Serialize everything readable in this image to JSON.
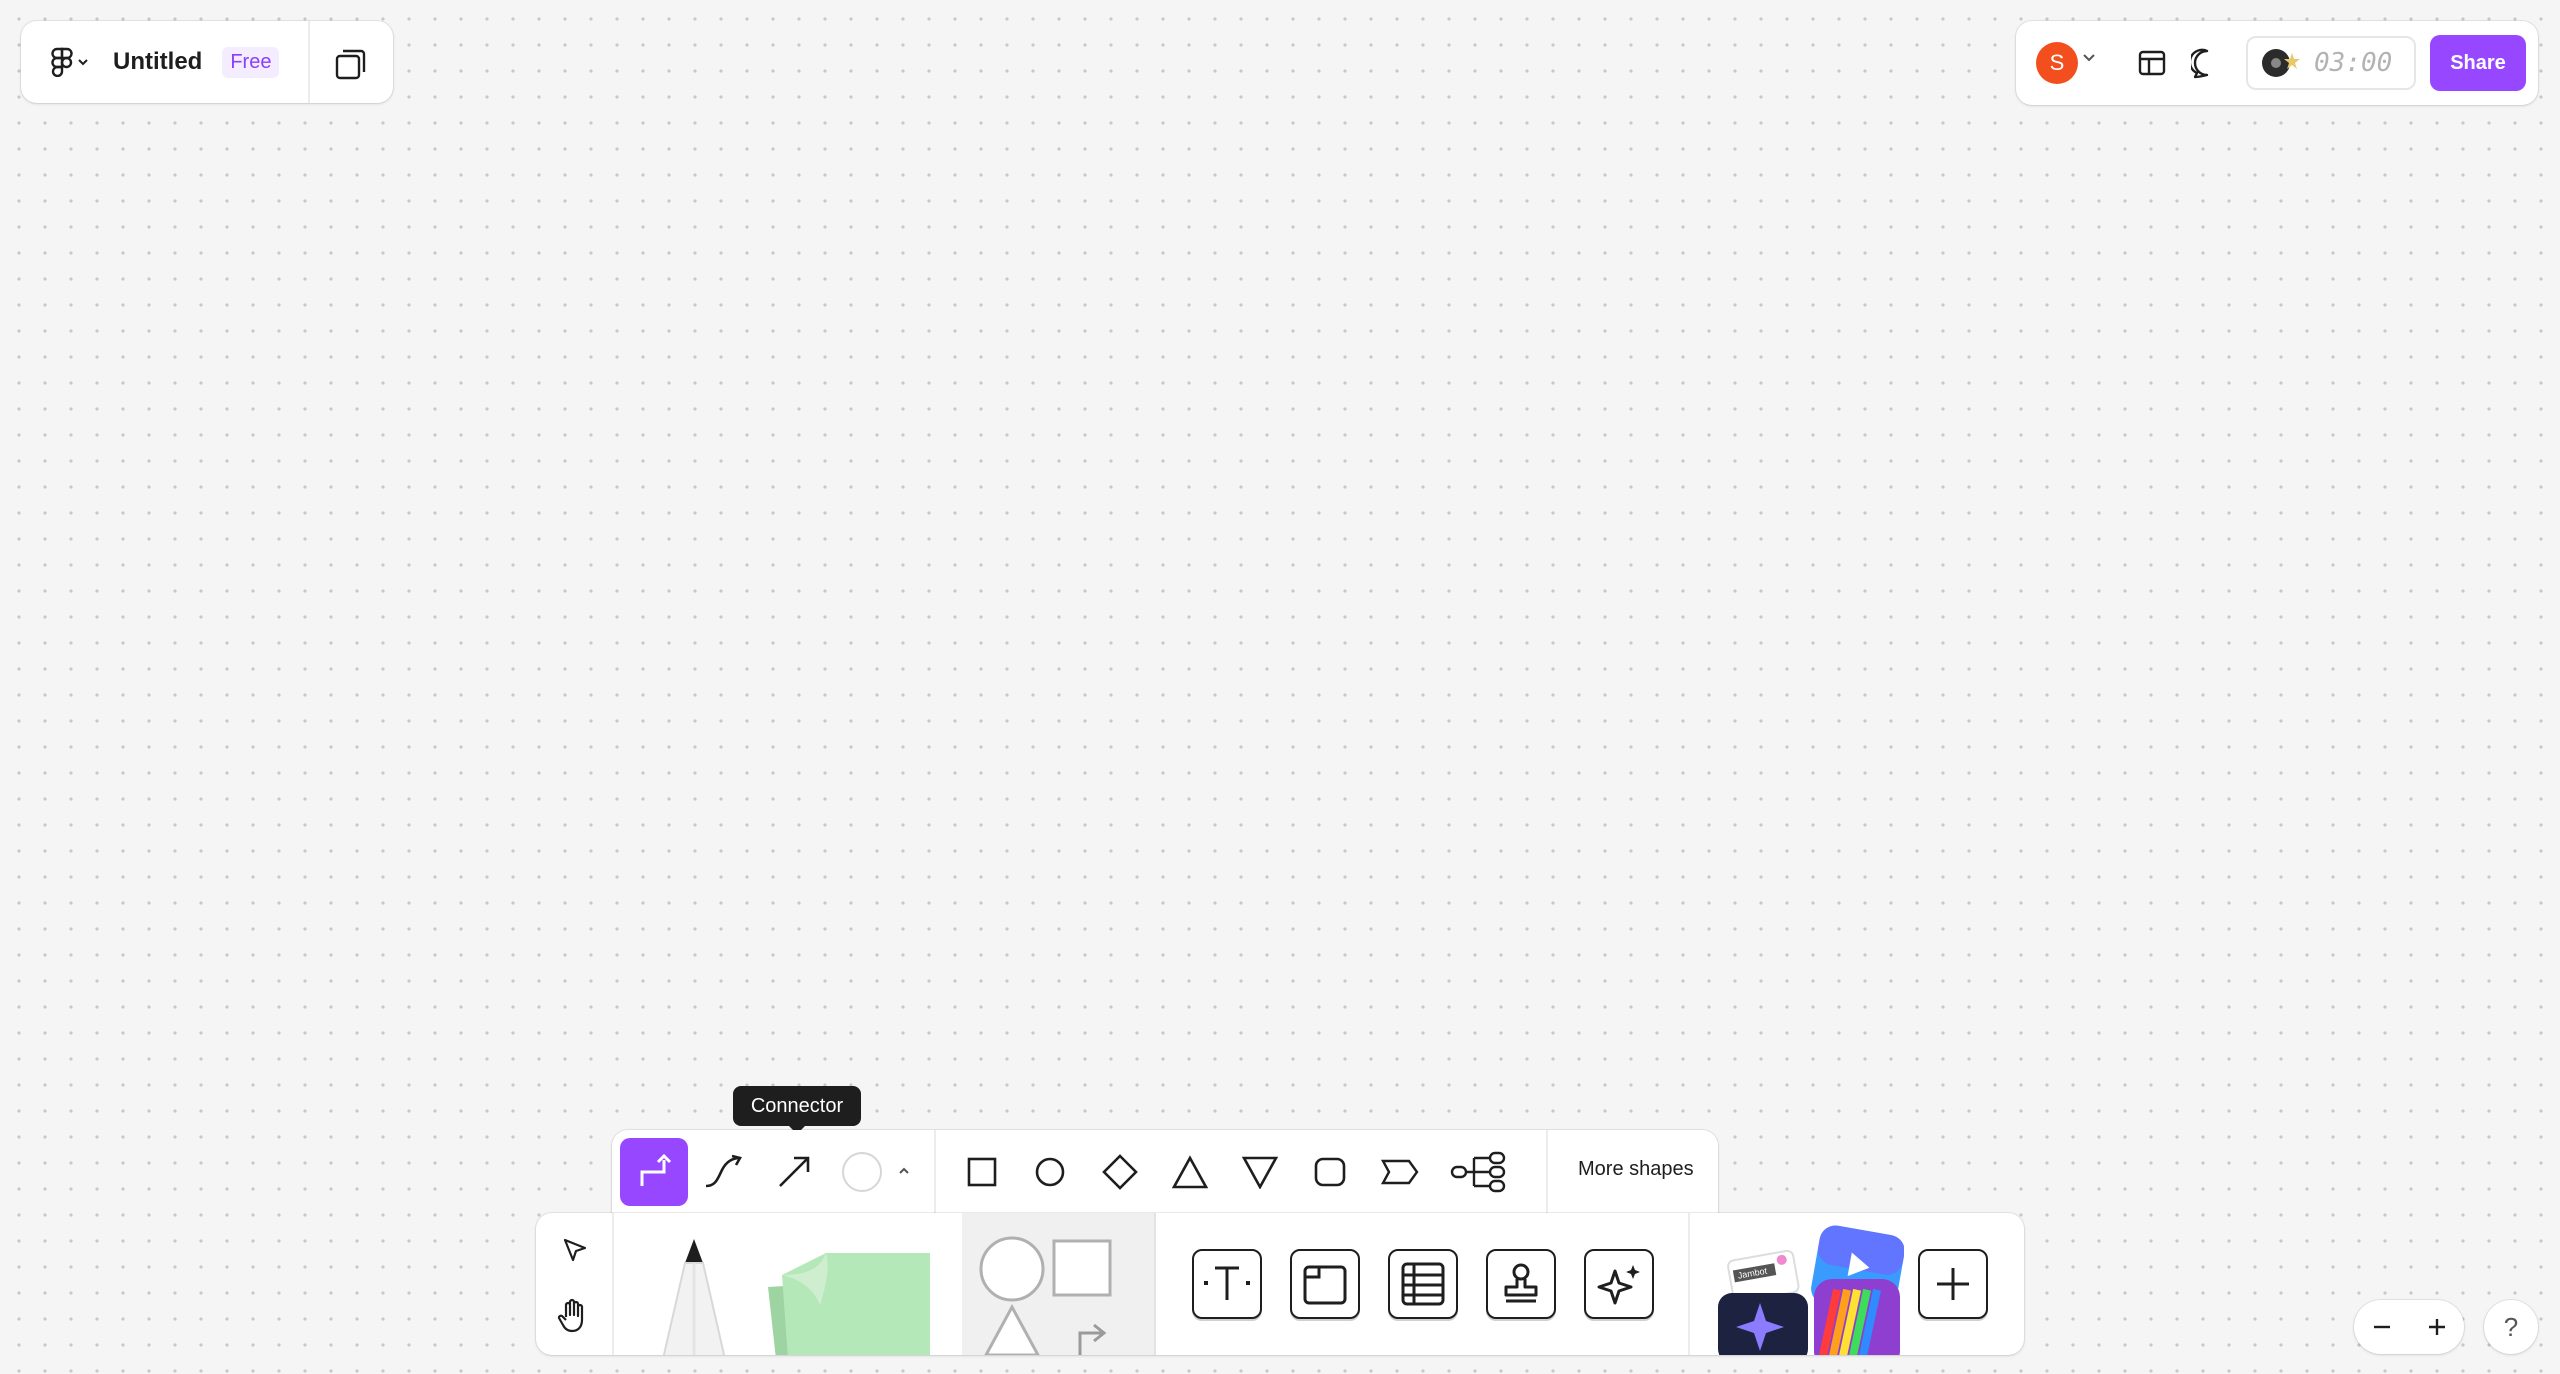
{
  "header": {
    "file_title": "Untitled",
    "plan_badge": "Free"
  },
  "top_right": {
    "avatar_initial": "S",
    "timer": "03:00",
    "share_label": "Share"
  },
  "tooltip": {
    "label": "Connector"
  },
  "shape_bar": {
    "more_shapes_label": "More shapes",
    "tools": [
      "elbow-connector",
      "curved-connector",
      "straight-connector",
      "color",
      "rectangle",
      "ellipse",
      "diamond",
      "triangle",
      "triangle-down",
      "rounded-rectangle",
      "chevron",
      "tree"
    ]
  },
  "main_toolbar": {
    "tools": [
      "move",
      "hand",
      "marker",
      "sticky",
      "shapes",
      "text",
      "section",
      "table",
      "stamp",
      "ai-widget",
      "plugins",
      "more"
    ],
    "sticker_text": "Jambot"
  },
  "zoom": {
    "help_label": "?"
  },
  "colors": {
    "accent": "#9747ff",
    "avatar": "#f24e1e",
    "sticky": "#b5e8b8"
  }
}
